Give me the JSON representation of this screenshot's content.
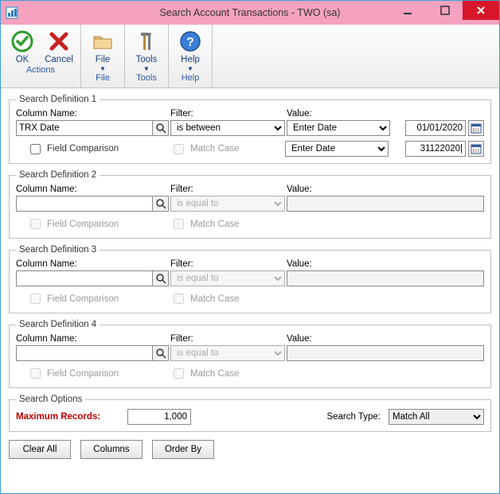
{
  "titlebar": {
    "text": "Search Account Transactions  -  TWO (sa)"
  },
  "ribbon": {
    "actions": {
      "ok": "OK",
      "cancel": "Cancel",
      "group": "Actions"
    },
    "file": {
      "btn": "File",
      "group": "File"
    },
    "tools": {
      "btn": "Tools",
      "group": "Tools"
    },
    "help": {
      "btn": "Help",
      "group": "Help"
    }
  },
  "labels": {
    "column_name": "Column Name:",
    "filter": "Filter:",
    "value": "Value:",
    "field_comparison": "Field Comparison",
    "match_case": "Match Case",
    "enter_date": "Enter Date"
  },
  "defs": [
    {
      "legend": "Search Definition 1",
      "column": "TRX Date",
      "filter": "is between",
      "enabled": true,
      "fc_checked": false,
      "dates": {
        "d1": "01/01/2020",
        "d2": "31122020|"
      }
    },
    {
      "legend": "Search Definition 2",
      "column": "",
      "filter": "is equal to",
      "enabled": false
    },
    {
      "legend": "Search Definition 3",
      "column": "",
      "filter": "is equal to",
      "enabled": false
    },
    {
      "legend": "Search Definition 4",
      "column": "",
      "filter": "is equal to",
      "enabled": false
    }
  ],
  "search_options": {
    "legend": "Search Options",
    "max_label": "Maximum Records:",
    "max_value": "1,000",
    "type_label": "Search Type:",
    "type_value": "Match All"
  },
  "buttons": {
    "clear_all": "Clear All",
    "columns": "Columns",
    "order_by": "Order By"
  }
}
